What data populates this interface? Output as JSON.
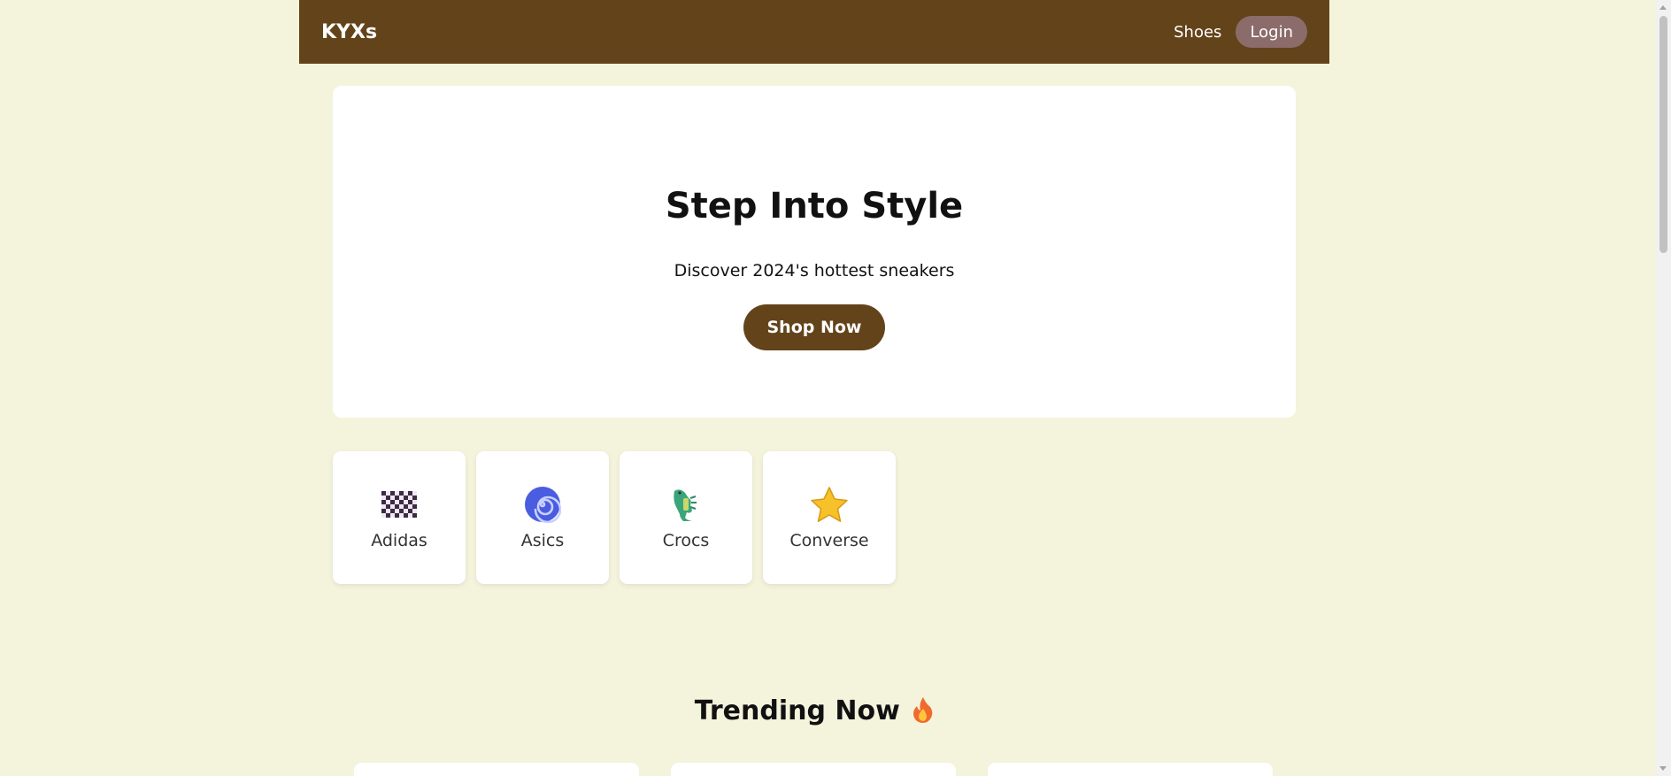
{
  "header": {
    "logo": "KYXs",
    "nav": {
      "shoes": "Shoes",
      "login": "Login"
    }
  },
  "hero": {
    "title": "Step Into Style",
    "subtitle": "Discover 2024's hottest sneakers",
    "cta": "Shop Now"
  },
  "brands": [
    {
      "label": "Adidas",
      "icon": "checkered-flag-icon"
    },
    {
      "label": "Asics",
      "icon": "spiral-icon"
    },
    {
      "label": "Crocs",
      "icon": "crocodile-icon"
    },
    {
      "label": "Converse",
      "icon": "star-icon"
    }
  ],
  "trending": {
    "title": "Trending Now",
    "icon": "fire-icon"
  },
  "colors": {
    "background": "#f4f3dc",
    "primary": "#63431a",
    "login_button": "#8c6b6b",
    "card": "#ffffff"
  }
}
